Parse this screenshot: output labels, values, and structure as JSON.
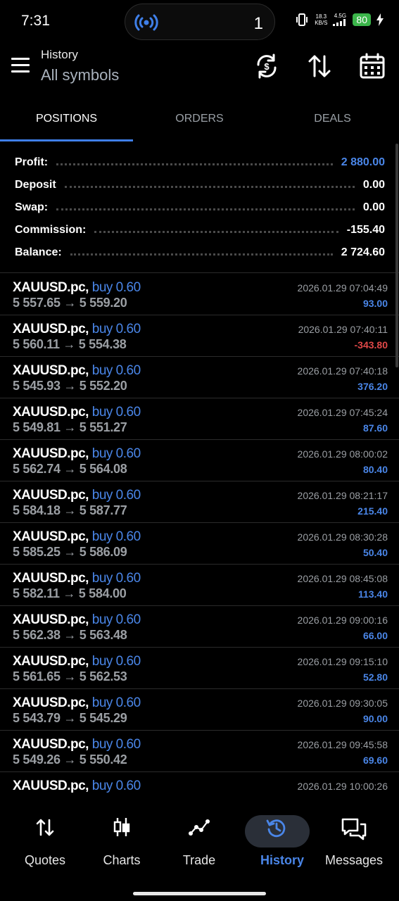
{
  "status_bar": {
    "time": "7:31",
    "island_count": "1",
    "speed_value": "18.3",
    "speed_unit": "KB/S",
    "network": "4.5G",
    "battery": "80"
  },
  "header": {
    "title": "History",
    "subtitle": "All symbols"
  },
  "tabs": [
    "POSITIONS",
    "ORDERS",
    "DEALS"
  ],
  "summary": {
    "profit_label": "Profit:",
    "profit_value": "2 880.00",
    "deposit_label": "Deposit",
    "deposit_value": "0.00",
    "swap_label": "Swap:",
    "swap_value": "0.00",
    "commission_label": "Commission:",
    "commission_value": "-155.40",
    "balance_label": "Balance:",
    "balance_value": "2 724.60"
  },
  "deals": [
    {
      "symbol": "XAUUSD.pc,",
      "type": "buy 0.60",
      "prices": "5 557.65 → 5 559.20",
      "datetime": "2026.01.29 07:04:49",
      "profit": "93.00"
    },
    {
      "symbol": "XAUUSD.pc,",
      "type": "buy 0.60",
      "prices": "5 560.11 → 5 554.38",
      "datetime": "2026.01.29 07:40:11",
      "profit": "-343.80"
    },
    {
      "symbol": "XAUUSD.pc,",
      "type": "buy 0.60",
      "prices": "5 545.93 → 5 552.20",
      "datetime": "2026.01.29 07:40:18",
      "profit": "376.20"
    },
    {
      "symbol": "XAUUSD.pc,",
      "type": "buy 0.60",
      "prices": "5 549.81 → 5 551.27",
      "datetime": "2026.01.29 07:45:24",
      "profit": "87.60"
    },
    {
      "symbol": "XAUUSD.pc,",
      "type": "buy 0.60",
      "prices": "5 562.74 → 5 564.08",
      "datetime": "2026.01.29 08:00:02",
      "profit": "80.40"
    },
    {
      "symbol": "XAUUSD.pc,",
      "type": "buy 0.60",
      "prices": "5 584.18 → 5 587.77",
      "datetime": "2026.01.29 08:21:17",
      "profit": "215.40"
    },
    {
      "symbol": "XAUUSD.pc,",
      "type": "buy 0.60",
      "prices": "5 585.25 → 5 586.09",
      "datetime": "2026.01.29 08:30:28",
      "profit": "50.40"
    },
    {
      "symbol": "XAUUSD.pc,",
      "type": "buy 0.60",
      "prices": "5 582.11 → 5 584.00",
      "datetime": "2026.01.29 08:45:08",
      "profit": "113.40"
    },
    {
      "symbol": "XAUUSD.pc,",
      "type": "buy 0.60",
      "prices": "5 562.38 → 5 563.48",
      "datetime": "2026.01.29 09:00:16",
      "profit": "66.00"
    },
    {
      "symbol": "XAUUSD.pc,",
      "type": "buy 0.60",
      "prices": "5 561.65 → 5 562.53",
      "datetime": "2026.01.29 09:15:10",
      "profit": "52.80"
    },
    {
      "symbol": "XAUUSD.pc,",
      "type": "buy 0.60",
      "prices": "5 543.79 → 5 545.29",
      "datetime": "2026.01.29 09:30:05",
      "profit": "90.00"
    },
    {
      "symbol": "XAUUSD.pc,",
      "type": "buy 0.60",
      "prices": "5 549.26 → 5 550.42",
      "datetime": "2026.01.29 09:45:58",
      "profit": "69.60"
    },
    {
      "symbol": "XAUUSD.pc,",
      "type": "buy 0.60",
      "prices": "",
      "datetime": "2026.01.29 10:00:26",
      "profit": ""
    }
  ],
  "bottom_nav": {
    "quotes": "Quotes",
    "charts": "Charts",
    "trade": "Trade",
    "history": "History",
    "messages": "Messages"
  },
  "colors": {
    "accent": "#4a86e8",
    "negative": "#e04848",
    "background": "#000000"
  }
}
